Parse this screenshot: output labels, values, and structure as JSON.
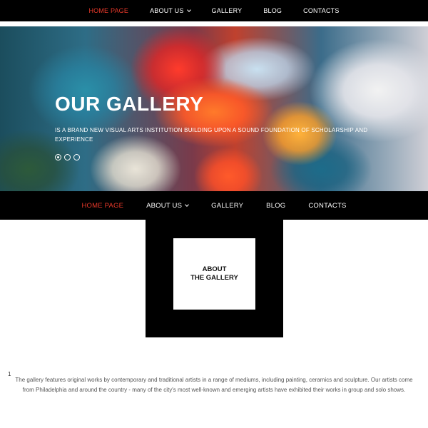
{
  "top_nav": {
    "items": [
      {
        "label": "HOME PAGE",
        "active": true,
        "has_dropdown": false
      },
      {
        "label": "ABOUT US",
        "active": false,
        "has_dropdown": true
      },
      {
        "label": "GALLERY",
        "active": false,
        "has_dropdown": false
      },
      {
        "label": "BLOG",
        "active": false,
        "has_dropdown": false
      },
      {
        "label": "CONTACTS",
        "active": false,
        "has_dropdown": false
      }
    ]
  },
  "hero": {
    "title": "OUR GALLERY",
    "subtitle": "IS A BRAND NEW VISUAL ARTS INSTITUTION BUILDING UPON A SOUND FOUNDATION OF SCHOLARSHIP AND EXPERIENCE",
    "slides_count": 3,
    "active_slide": 1
  },
  "main_nav": {
    "items": [
      {
        "label": "HOME PAGE",
        "active": true,
        "has_dropdown": false
      },
      {
        "label": "ABOUT US",
        "active": false,
        "has_dropdown": true
      },
      {
        "label": "GALLERY",
        "active": false,
        "has_dropdown": false
      },
      {
        "label": "BLOG",
        "active": false,
        "has_dropdown": false
      },
      {
        "label": "CONTACTS",
        "active": false,
        "has_dropdown": false
      }
    ]
  },
  "about": {
    "line1": "ABOUT",
    "line2": "THE GALLERY"
  },
  "body": {
    "marker": "1",
    "text": "The gallery features original works by contemporary and traditional artists in a range of mediums, including painting, ceramics and sculpture. Our artists come from Philadelphia and around the country - many of the city's most well-known and emerging artists have exhibited their works in group and solo shows."
  },
  "colors": {
    "accent": "#e8392a",
    "nav_bg": "#000000",
    "nav_text": "#ffffff",
    "body_text": "#555555"
  },
  "icons": {
    "dropdown": "chevron-down-icon"
  }
}
